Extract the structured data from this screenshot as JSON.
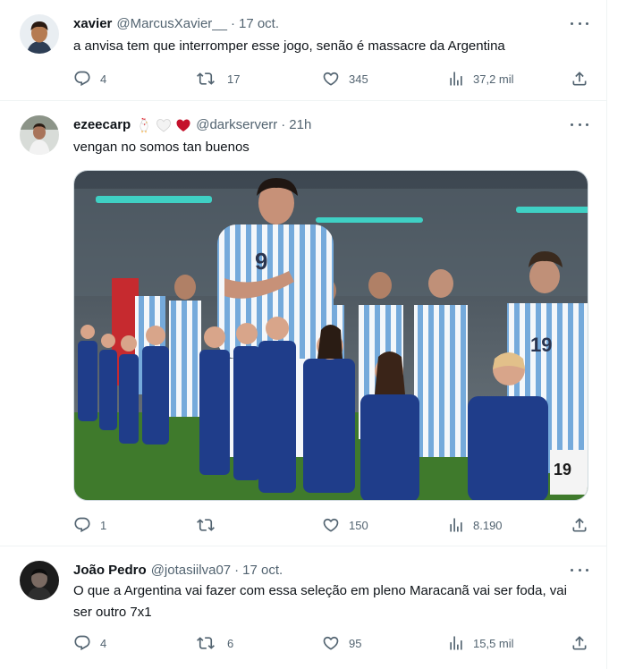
{
  "tweets": [
    {
      "name": "xavier",
      "handle": "@MarcusXavier__",
      "time": "17 oct.",
      "text": "a anvisa tem que interromper esse jogo, senão é massacre da Argentina",
      "replies": "4",
      "retweets": "17",
      "likes": "345",
      "views": "37,2 mil"
    },
    {
      "name": "ezeecarp",
      "handle": "@darkserverr",
      "time": "21h",
      "name_emojis": [
        "rooster-icon",
        "white-heart-icon",
        "red-heart-icon"
      ],
      "text": "vengan no somos tan buenos",
      "replies": "1",
      "retweets": "",
      "likes": "150",
      "views": "8.190"
    },
    {
      "name": "João Pedro",
      "handle": "@jotasiilva07",
      "time": "17 oct.",
      "text": "O que a Argentina vai fazer com essa seleção em pleno Maracanã vai ser foda, vai ser outro 7x1",
      "replies": "4",
      "retweets": "6",
      "likes": "95",
      "views": "15,5 mil"
    }
  ],
  "media": {
    "jersey_numbers": [
      "9",
      "19"
    ]
  },
  "colors": {
    "text": "#0f1419",
    "secondary": "#536471",
    "border": "#eff3f4",
    "jersey_blue": "#75aadb",
    "heart_red": "#c4112b"
  }
}
